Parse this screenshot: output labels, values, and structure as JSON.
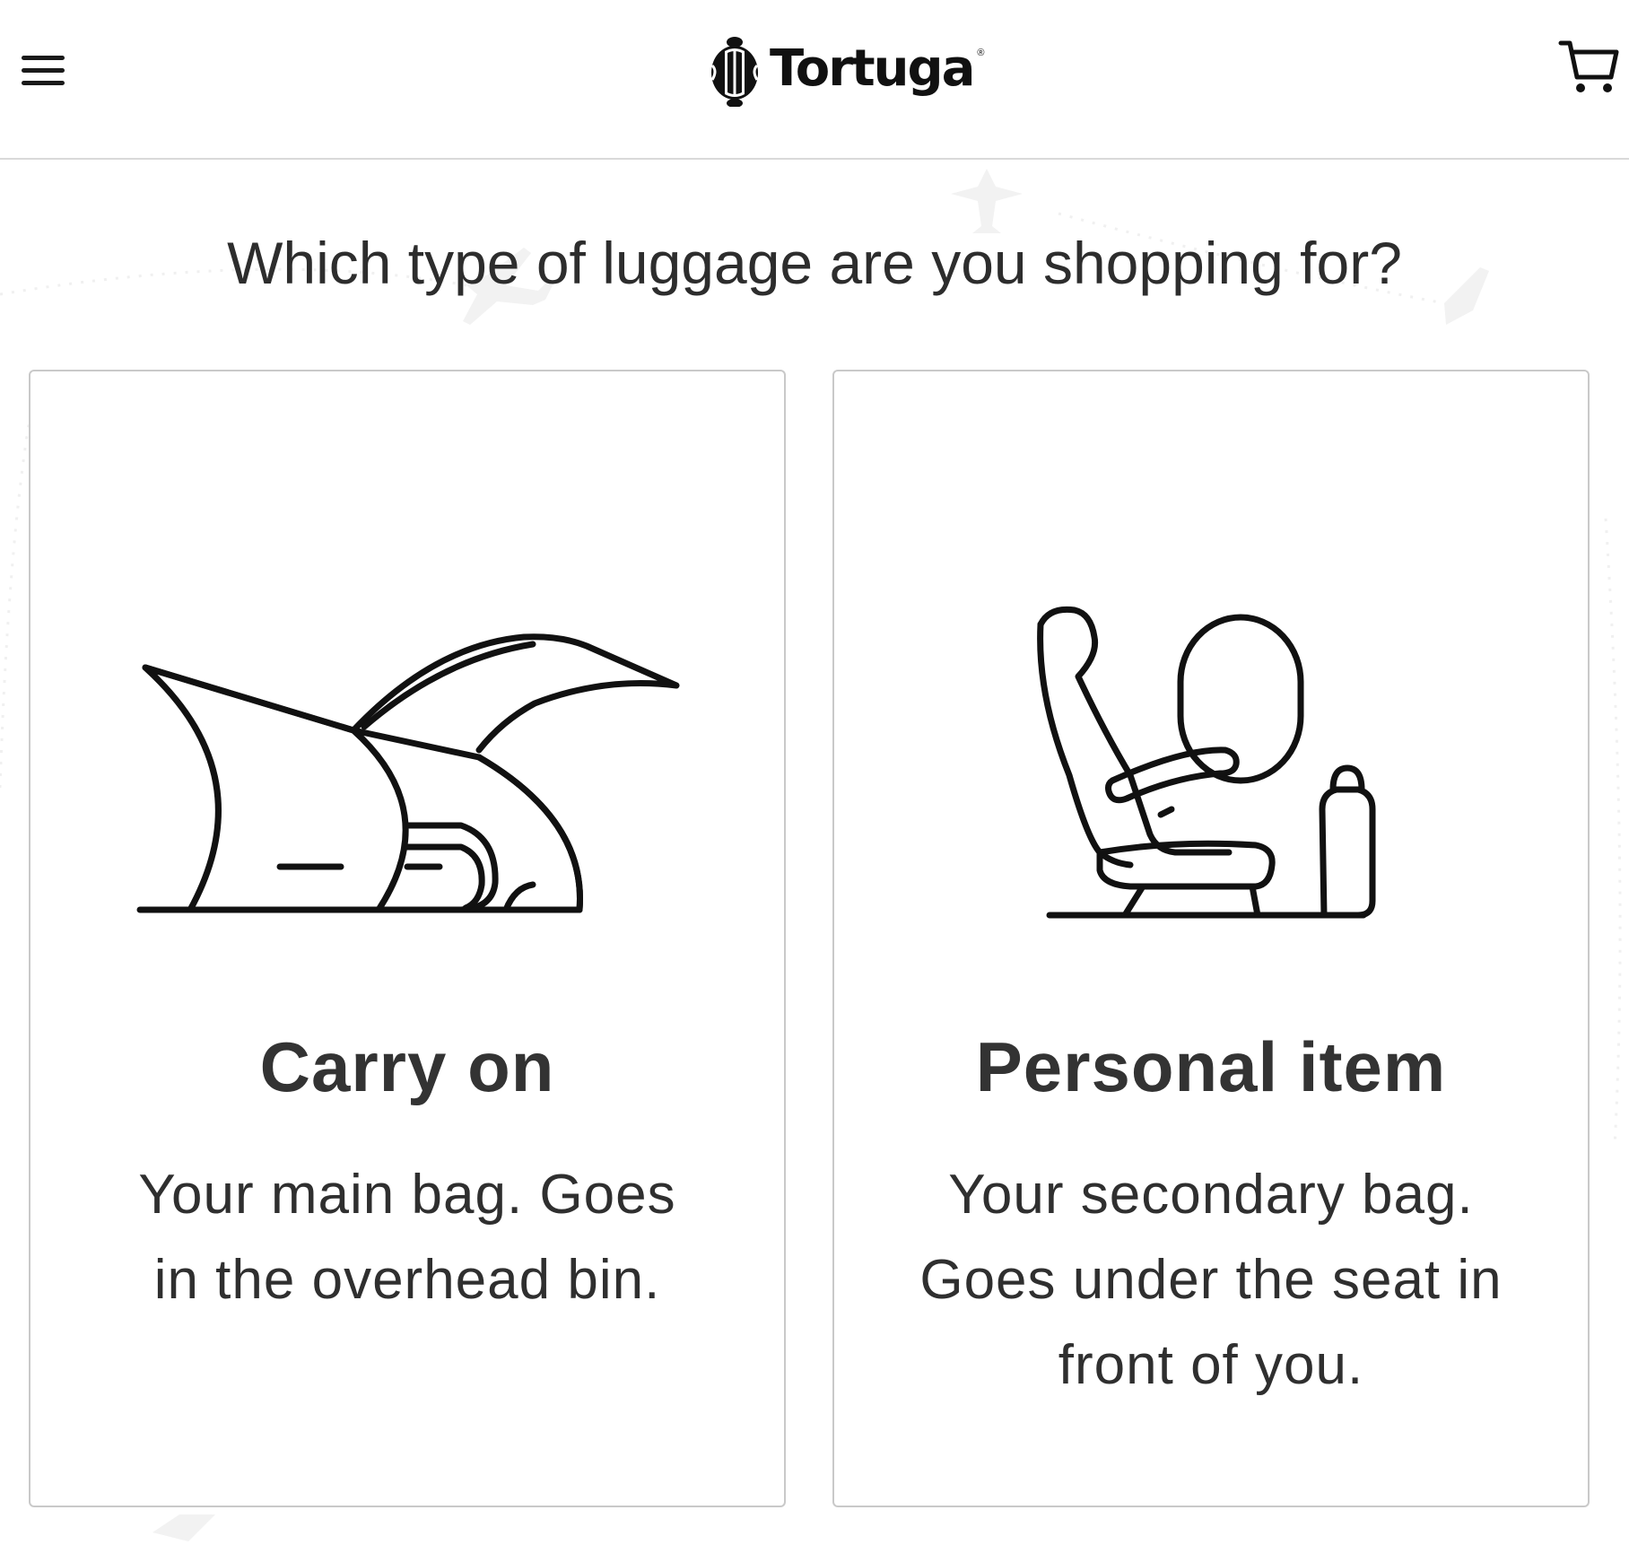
{
  "header": {
    "menu_icon": "hamburger-menu-icon",
    "brand_name": "Tortuga",
    "brand_mark": "®",
    "cart_icon": "shopping-cart-icon"
  },
  "main": {
    "question": "Which type of luggage are you shopping for?",
    "options": [
      {
        "title": "Carry on",
        "description": "Your main bag. Goes in the overhead bin.",
        "icon": "overhead-bin-icon"
      },
      {
        "title": "Personal item",
        "description": "Your secondary bag. Goes under the seat in front of you.",
        "icon": "airplane-seat-icon"
      }
    ]
  },
  "colors": {
    "text": "#2b2b2b",
    "card_border": "#c9c9c9",
    "header_border": "#d9d9d9",
    "background": "#ffffff"
  }
}
